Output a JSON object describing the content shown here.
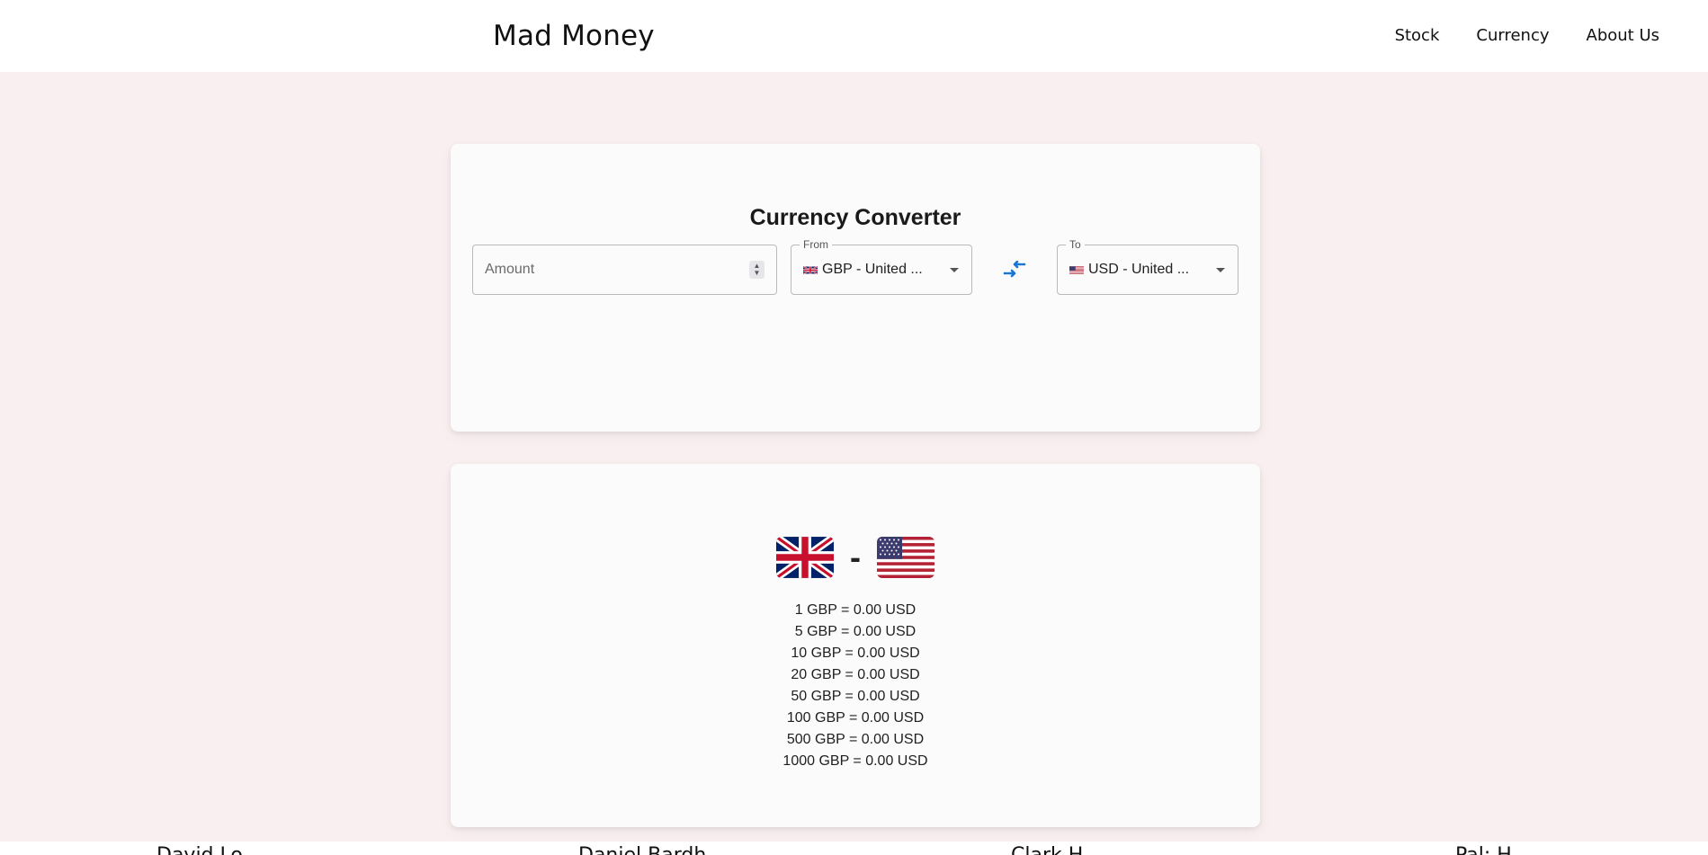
{
  "header": {
    "brand": "Mad Money",
    "nav": [
      {
        "label": "Stock"
      },
      {
        "label": "Currency"
      },
      {
        "label": "About Us"
      }
    ]
  },
  "converter": {
    "title": "Currency Converter",
    "amount": {
      "placeholder": "Amount",
      "value": ""
    },
    "from": {
      "legend": "From",
      "value": "GBP - United ...",
      "flag": "uk-flag-icon"
    },
    "to": {
      "legend": "To",
      "value": "USD - United ...",
      "flag": "us-flag-icon"
    },
    "swap_icon": "swap-arrows-icon",
    "accent_color": "#1976d2"
  },
  "rates": {
    "separator": "-",
    "items": [
      "1 GBP = 0.00 USD",
      "5 GBP = 0.00 USD",
      "10 GBP = 0.00 USD",
      "20 GBP = 0.00 USD",
      "50 GBP = 0.00 USD",
      "100 GBP = 0.00 USD",
      "500 GBP = 0.00 USD",
      "1000 GBP = 0.00 USD"
    ]
  },
  "footer": {
    "names": [
      "David Lo",
      "Daniel Bardh",
      "Clark H",
      "Pal: H"
    ]
  },
  "colors": {
    "page_background": "#f9eff0",
    "card_background": "#fbfbfb",
    "header_background": "#ffffff"
  }
}
